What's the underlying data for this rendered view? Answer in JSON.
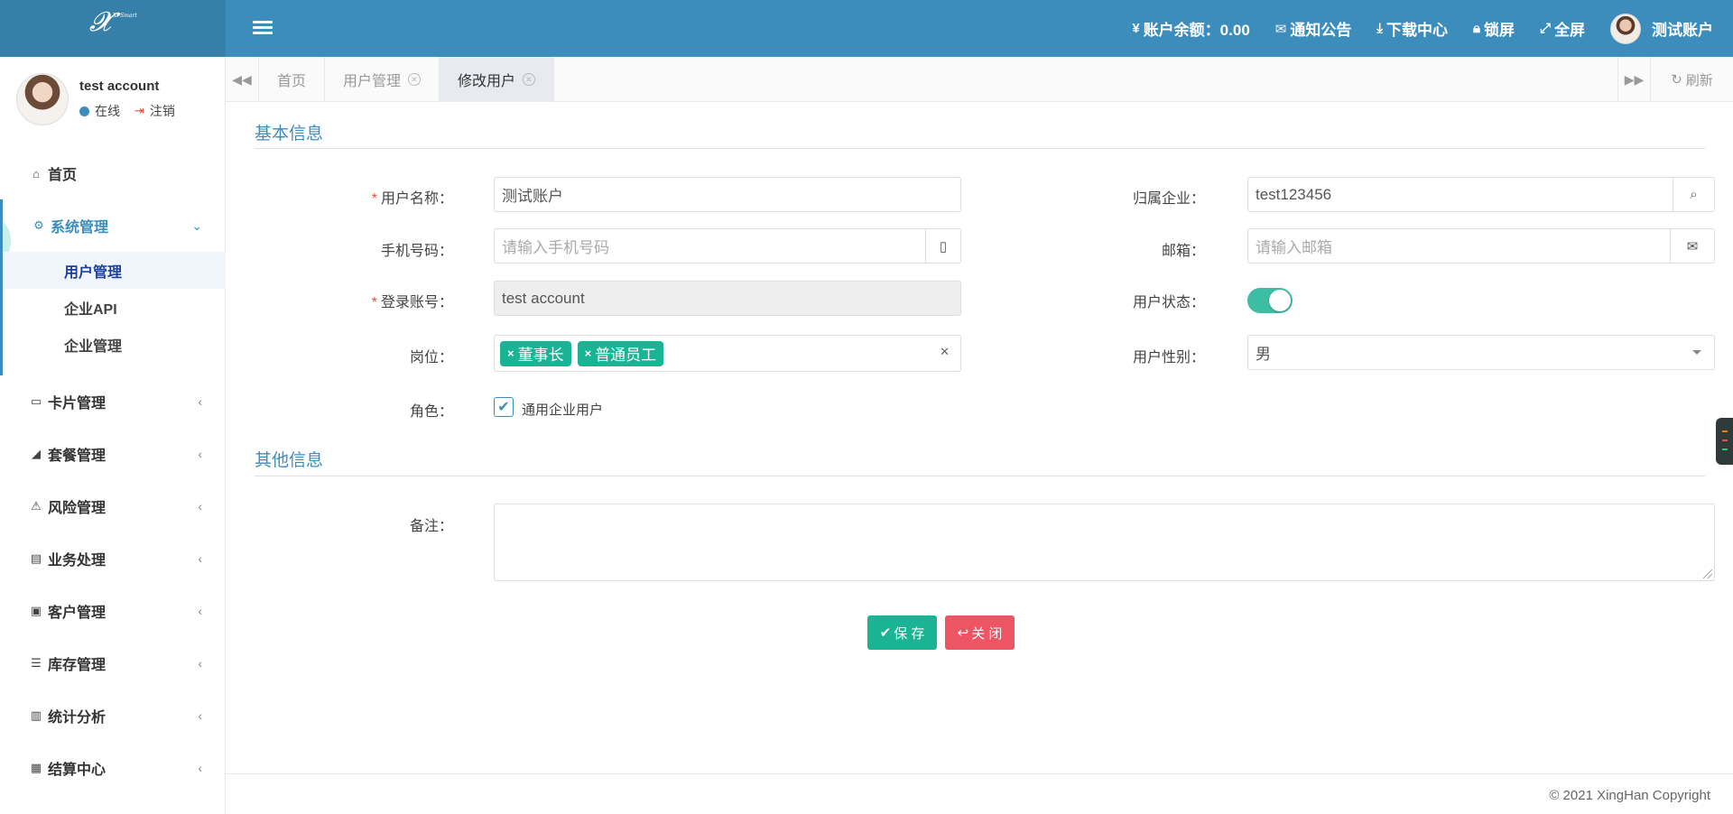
{
  "header": {
    "logo_text": "Xi Smart",
    "balance": "账户余额：0.00",
    "notices": "通知公告",
    "downloads": "下载中心",
    "lock": "锁屏",
    "fullscreen": "全屏",
    "user": "测试账户"
  },
  "sidebar": {
    "user_name": "test account",
    "status": "在线",
    "logout": "注销",
    "menu": [
      {
        "label": "首页",
        "icon": "home-icon"
      },
      {
        "label": "系统管理",
        "icon": "gear-icon"
      },
      {
        "label": "卡片管理",
        "icon": "card-icon"
      },
      {
        "label": "套餐管理",
        "icon": "area-chart-icon"
      },
      {
        "label": "风险管理",
        "icon": "warning-icon"
      },
      {
        "label": "业务处理",
        "icon": "book-icon"
      },
      {
        "label": "客户管理",
        "icon": "contact-icon"
      },
      {
        "label": "库存管理",
        "icon": "database-icon"
      },
      {
        "label": "统计分析",
        "icon": "bar-chart-icon"
      },
      {
        "label": "结算中心",
        "icon": "calculator-icon"
      }
    ],
    "submenu": [
      "用户管理",
      "企业API",
      "企业管理"
    ]
  },
  "tabs": {
    "items": [
      "首页",
      "用户管理",
      "修改用户"
    ],
    "refresh": "刷新"
  },
  "form": {
    "section_basic": "基本信息",
    "section_other": "其他信息",
    "username_label": "用户名称：",
    "username_value": "测试账户",
    "company_label": "归属企业：",
    "company_value": "test123456",
    "phone_label": "手机号码：",
    "phone_placeholder": "请输入手机号码",
    "email_label": "邮箱：",
    "email_placeholder": "请输入邮箱",
    "login_label": "登录账号：",
    "login_value": "test account",
    "status_label": "用户状态：",
    "status_on": true,
    "post_label": "岗位：",
    "posts": [
      "董事长",
      "普通员工"
    ],
    "gender_label": "用户性别：",
    "gender_value": "男",
    "role_label": "角色：",
    "role_value": "通用企业用户",
    "role_checked": true,
    "remark_label": "备注：",
    "save": "保 存",
    "close": "关 闭"
  },
  "footer": {
    "copyright": "© 2021 XingHan Copyright"
  },
  "colors": {
    "header": "#3c8dbc",
    "logo_bg": "#367fa9",
    "primary_green": "#1ab394",
    "danger_red": "#ed5565"
  }
}
